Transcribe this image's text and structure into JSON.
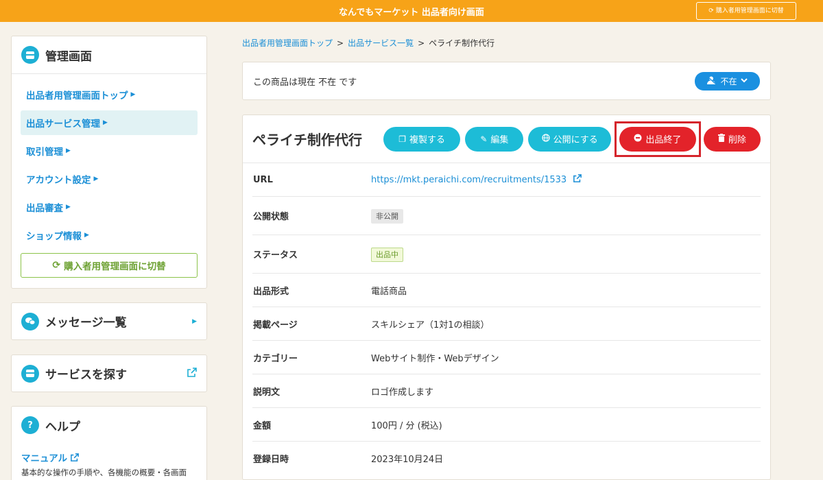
{
  "topbar": {
    "title": "なんでもマーケット 出品者向け画面",
    "switch_label": "購入者用管理画面に切替",
    "switch_icon": "refresh-icon"
  },
  "sidebar": {
    "title": "管理画面",
    "items": [
      {
        "label": "出品者用管理画面トップ"
      },
      {
        "label": "出品サービス管理"
      },
      {
        "label": "取引管理"
      },
      {
        "label": "アカウント設定"
      },
      {
        "label": "出品審査"
      },
      {
        "label": "ショップ情報"
      }
    ],
    "switch_label": "購入者用管理画面に切替",
    "messages_title": "メッセージ一覧",
    "search_title": "サービスを探す",
    "help_title": "ヘルプ",
    "help_icon_glyph": "?",
    "manual_label": "マニュアル",
    "manual_desc": "基本的な操作の手順や、各機能の概要・各画面"
  },
  "breadcrumb": {
    "items": [
      "出品者用管理画面トップ",
      "出品サービス一覧",
      "ペライチ制作代行"
    ],
    "separator": ">"
  },
  "status": {
    "text": "この商品は現在 不在 です",
    "pill_label": "不在"
  },
  "product": {
    "name": "ペライチ制作代行",
    "buttons": {
      "duplicate": "複製する",
      "edit": "編集",
      "publish": "公開にする",
      "end": "出品終了",
      "delete": "削除"
    },
    "rows": [
      {
        "key": "URL",
        "value": "https://mkt.peraichi.com/recruitments/1533"
      },
      {
        "key": "公開状態",
        "value": "非公開"
      },
      {
        "key": "ステータス",
        "value": "出品中"
      },
      {
        "key": "出品形式",
        "value": "電話商品"
      },
      {
        "key": "掲載ページ",
        "value": "スキルシェア（1対1の相談）"
      },
      {
        "key": "カテゴリー",
        "value": "Webサイト制作・Webデザイン"
      },
      {
        "key": "説明文",
        "value": "ロゴ作成します"
      },
      {
        "key": "金額",
        "value": "100円 / 分 (税込)"
      },
      {
        "key": "登録日時",
        "value": "2023年10月24日"
      }
    ]
  },
  "colors": {
    "topbar": "#f7a318",
    "accent_cyan": "#1dbcd7",
    "danger": "#e3232a",
    "link": "#1b8fd6",
    "highlight_border": "#d5252c"
  }
}
